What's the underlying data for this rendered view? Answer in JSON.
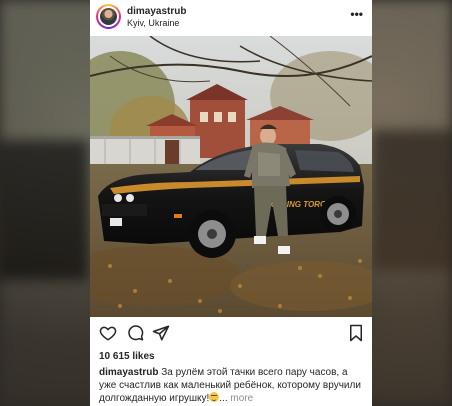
{
  "post": {
    "username": "dimayastrub",
    "location": "Kyiv, Ukraine",
    "more_menu": "•••",
    "photo_car_text": "ROLLING TORQUE",
    "likes": "10 615 likes",
    "caption": {
      "username": "dimayastrub",
      "text": "За рулём этой тачки всего пару часов, а уже счастлив как маленький ребёнок, которому вручили долгожданную игрушку!",
      "ellipsis": "...",
      "more_label": "more"
    }
  },
  "icons": {
    "more": "more-horizontal-icon",
    "like": "heart-icon",
    "comment": "comment-bubble-icon",
    "share": "paper-plane-icon",
    "save": "bookmark-icon"
  },
  "colors": {
    "text": "#262626",
    "muted": "#8e8e8e",
    "background": "#ffffff"
  }
}
